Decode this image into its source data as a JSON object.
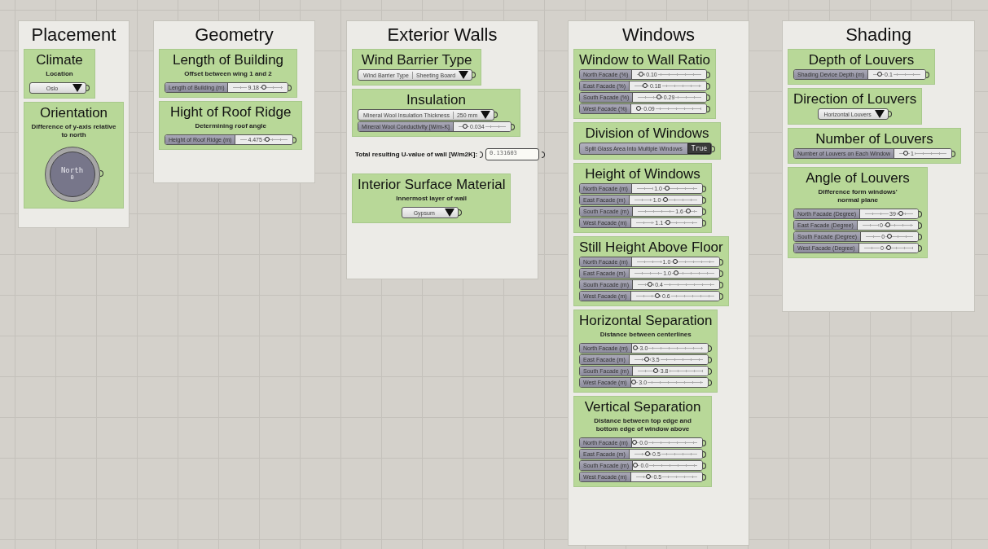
{
  "groups": [
    {
      "title": "Placement",
      "items": [
        {
          "kind": "card",
          "title": "Climate",
          "subtitle": "Location",
          "controls": [
            {
              "kind": "dropdown",
              "value": "Oslo"
            }
          ]
        },
        {
          "kind": "card",
          "title": "Orientation",
          "subtitle": "Difference of y-axis relative to north",
          "controls": [
            {
              "kind": "dial",
              "label": "North",
              "value": "0"
            }
          ]
        }
      ]
    },
    {
      "title": "Geometry",
      "items": [
        {
          "kind": "card",
          "title": "Length of Building",
          "subtitle": "Offset between wing 1 and 2",
          "controls": [
            {
              "kind": "slider",
              "label": "Length of Building (m)",
              "value": "9.18",
              "level": 0.6
            }
          ]
        },
        {
          "kind": "card",
          "title": "Hight of Roof Ridge",
          "subtitle": "Determining roof angle",
          "controls": [
            {
              "kind": "slider",
              "label": "Height of Roof Ridge (m)",
              "value": "4.475",
              "level": 0.55
            }
          ]
        }
      ]
    },
    {
      "title": "Exterior Walls",
      "items": [
        {
          "kind": "card",
          "title": "Wind Barrier Type",
          "controls": [
            {
              "kind": "dropdown",
              "label": "Wind Barrier Type",
              "value": "Sheeting Board"
            }
          ]
        },
        {
          "kind": "card",
          "title": "Insulation",
          "controls": [
            {
              "kind": "dropdown",
              "label": "Mineral Wool Insulation Thickness",
              "value": "250 mm"
            },
            {
              "kind": "slider",
              "label": "Mineral Wool Conductivity [W/m-K]",
              "value": "0.034",
              "level": 0.2
            }
          ]
        },
        {
          "kind": "readout",
          "label": "Total resulting U-value of wall [W/m2K]:",
          "value": "0.131603"
        },
        {
          "kind": "card",
          "title": "Interior Surface Material",
          "subtitle": "Innermost layer of wall",
          "controls": [
            {
              "kind": "dropdown",
              "value": "Gypsum"
            }
          ]
        }
      ]
    },
    {
      "title": "Windows",
      "items": [
        {
          "kind": "card",
          "title": "Window to Wall Ratio",
          "controls": [
            {
              "kind": "slider",
              "label": "North Facade (%)",
              "value": "0.10",
              "level": 0.12
            },
            {
              "kind": "slider",
              "label": "East Facade (%)",
              "value": "0.18",
              "level": 0.2
            },
            {
              "kind": "slider",
              "label": "South Facade (%)",
              "value": "0.29",
              "level": 0.35
            },
            {
              "kind": "slider",
              "label": "West Facade (%)",
              "value": "0.09",
              "level": 0.1
            }
          ]
        },
        {
          "kind": "card",
          "title": "Division of Windows",
          "controls": [
            {
              "kind": "toggle",
              "label": "Split Glass Area Into Multiple Windows",
              "value": "True",
              "on": true
            }
          ]
        },
        {
          "kind": "card",
          "title": "Height of Windows",
          "controls": [
            {
              "kind": "slider",
              "label": "North Facade (m)",
              "value": "1.0",
              "level": 0.5
            },
            {
              "kind": "slider",
              "label": "East Facade (m)",
              "value": "1.0",
              "level": 0.5
            },
            {
              "kind": "slider",
              "label": "South Facade (m)",
              "value": "1.6",
              "level": 0.8
            },
            {
              "kind": "slider",
              "label": "West Facade (m)",
              "value": "1.1",
              "level": 0.52
            }
          ]
        },
        {
          "kind": "card",
          "title": "Still Height Above Floor",
          "controls": [
            {
              "kind": "slider",
              "label": "North Facade (m)",
              "value": "1.0",
              "level": 0.5
            },
            {
              "kind": "slider",
              "label": "East Facade (m)",
              "value": "1.0",
              "level": 0.52
            },
            {
              "kind": "slider",
              "label": "South Facade (m)",
              "value": "0.4",
              "level": 0.2
            },
            {
              "kind": "slider",
              "label": "West Facade (m)",
              "value": "0.6",
              "level": 0.3
            }
          ]
        },
        {
          "kind": "card",
          "title": "Horizontal Separation",
          "subtitle": "Distance between centerlines",
          "controls": [
            {
              "kind": "slider",
              "label": "North Facade (m)",
              "value": "3.0",
              "level": 0.04
            },
            {
              "kind": "slider",
              "label": "East Facade (m)",
              "value": "3.5",
              "level": 0.22
            },
            {
              "kind": "slider",
              "label": "South Facade (m)",
              "value": "3.8",
              "level": 0.3
            },
            {
              "kind": "slider",
              "label": "West Facade (m)",
              "value": "3.0",
              "level": 0.04
            }
          ]
        },
        {
          "kind": "card",
          "title": "Vertical Separation",
          "subtitle": "Distance between top edge and bottom edge of window above",
          "controls": [
            {
              "kind": "slider",
              "label": "North Facade (m)",
              "value": "0.0",
              "level": 0.04
            },
            {
              "kind": "slider",
              "label": "East Facade (m)",
              "value": "0.5",
              "level": 0.25
            },
            {
              "kind": "slider",
              "label": "South Facade (m)",
              "value": "0.0",
              "level": 0.04
            },
            {
              "kind": "slider",
              "label": "West Facade (m)",
              "value": "0.5",
              "level": 0.25
            }
          ]
        }
      ]
    },
    {
      "title": "Shading",
      "items": [
        {
          "kind": "card",
          "title": "Depth of Louvers",
          "controls": [
            {
              "kind": "slider",
              "label": "Shading Device Depth (m)",
              "value": "0.1",
              "level": 0.2
            }
          ]
        },
        {
          "kind": "card",
          "title": "Direction of Louvers",
          "controls": [
            {
              "kind": "dropdown",
              "value": "Horizontal Louvers"
            }
          ]
        },
        {
          "kind": "card",
          "title": "Number of Louvers",
          "controls": [
            {
              "kind": "slider",
              "label": "Number of Louvers on Each Window",
              "value": "1",
              "level": 0.2
            }
          ]
        },
        {
          "kind": "card",
          "title": "Angle of Louvers",
          "subtitle": "Difference form windows' normal plane",
          "controls": [
            {
              "kind": "slider",
              "label": "North Facade (Degree)",
              "value": "39",
              "level": 0.7
            },
            {
              "kind": "slider",
              "label": "East Facade (Degree)",
              "value": "0",
              "level": 0.5
            },
            {
              "kind": "slider",
              "label": "South Facade (Degree)",
              "value": "0",
              "level": 0.5
            },
            {
              "kind": "slider",
              "label": "West Facade (Degree)",
              "value": "0",
              "level": 0.5
            }
          ]
        }
      ]
    }
  ]
}
